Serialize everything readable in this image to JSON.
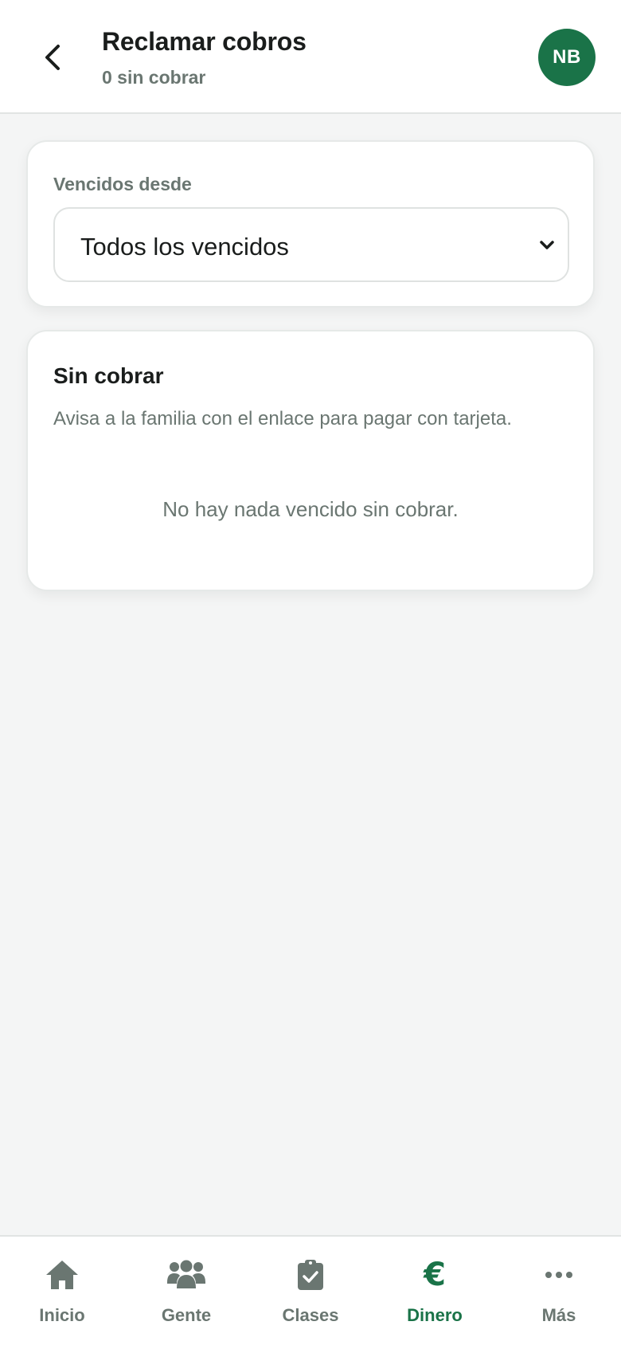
{
  "header": {
    "title": "Reclamar cobros",
    "subtitle": "0 sin cobrar",
    "avatar_initials": "NB",
    "back_icon": "chevron-left-icon"
  },
  "filter": {
    "label": "Vencidos desde",
    "selected": "Todos los vencidos",
    "chevron_icon": "chevron-down-icon"
  },
  "pending": {
    "title": "Sin cobrar",
    "description": "Avisa a la familia con el enlace para pagar con tarjeta.",
    "empty_message": "No hay nada vencido sin cobrar."
  },
  "nav": {
    "items": [
      {
        "label": "Inicio",
        "icon": "home-icon",
        "active": false
      },
      {
        "label": "Gente",
        "icon": "people-icon",
        "active": false
      },
      {
        "label": "Clases",
        "icon": "clipboard-check-icon",
        "active": false
      },
      {
        "label": "Dinero",
        "icon": "euro-icon",
        "active": true
      },
      {
        "label": "Más",
        "icon": "more-icon",
        "active": false
      }
    ]
  },
  "colors": {
    "brand": "#1a7348",
    "muted_text": "#6a7671",
    "background": "#f4f5f5"
  }
}
